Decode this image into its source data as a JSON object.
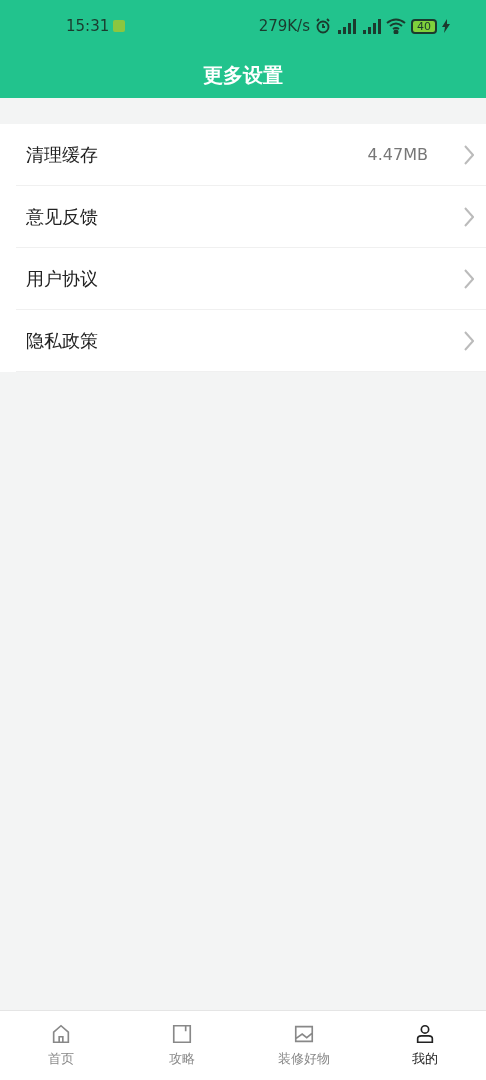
{
  "status_bar": {
    "time": "15:31",
    "speed": "279K/s",
    "battery": "40"
  },
  "header": {
    "title": "更多设置"
  },
  "settings": [
    {
      "label": "清理缓存",
      "value": "4.47MB"
    },
    {
      "label": "意见反馈"
    },
    {
      "label": "用户协议"
    },
    {
      "label": "隐私政策"
    }
  ],
  "tab_bar": [
    {
      "kind": "home",
      "label": "首页",
      "selected": false
    },
    {
      "kind": "guide",
      "label": "攻略",
      "selected": false
    },
    {
      "kind": "goods",
      "label": "装修好物",
      "selected": false
    },
    {
      "kind": "me",
      "label": "我的",
      "selected": true
    }
  ]
}
